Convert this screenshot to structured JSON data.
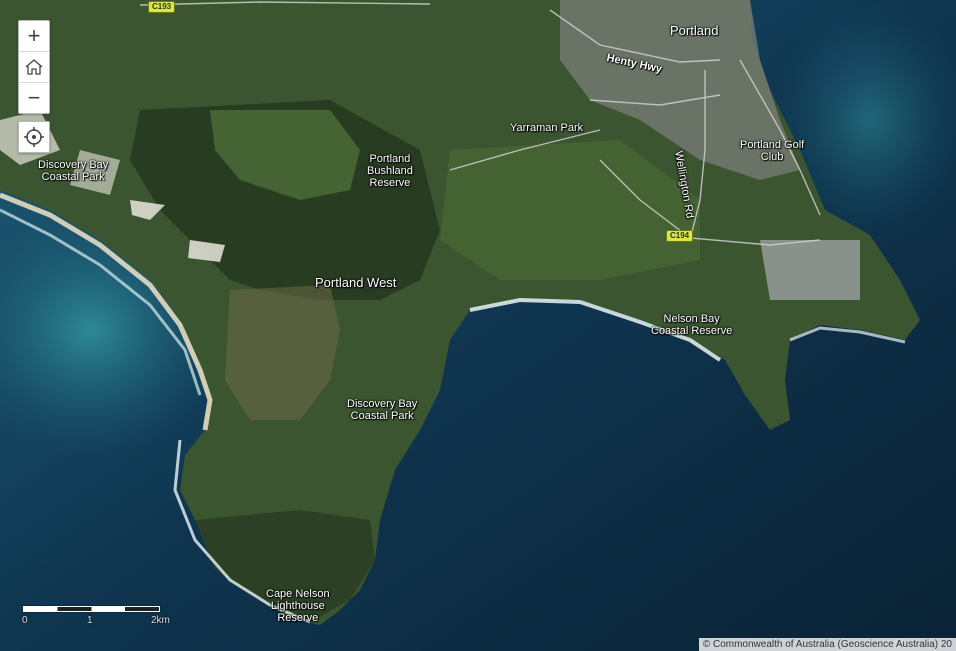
{
  "controls": {
    "zoom_in": "+",
    "zoom_out": "−"
  },
  "places": {
    "portland": "Portland",
    "henty_hwy": "Henty Hwy",
    "yarraman_park": "Yarraman Park",
    "wellington_rd": "Wellington Rd",
    "portland_golf_club": "Portland Golf\nClub",
    "discovery_bay_nw": "Discovery Bay\nCoastal Park",
    "portland_bushland": "Portland\nBushland\nReserve",
    "portland_west": "Portland West",
    "nelson_bay": "Nelson Bay\nCoastal Reserve",
    "discovery_bay_s": "Discovery Bay\nCoastal Park",
    "cape_nelson": "Cape Nelson\nLighthouse\nReserve"
  },
  "shields": {
    "c193": "C193",
    "c194": "C194"
  },
  "scale": {
    "l0": "0",
    "l1": "1",
    "l2": "2km"
  },
  "attribution": "© Commonwealth of Australia (Geoscience Australia) 20"
}
